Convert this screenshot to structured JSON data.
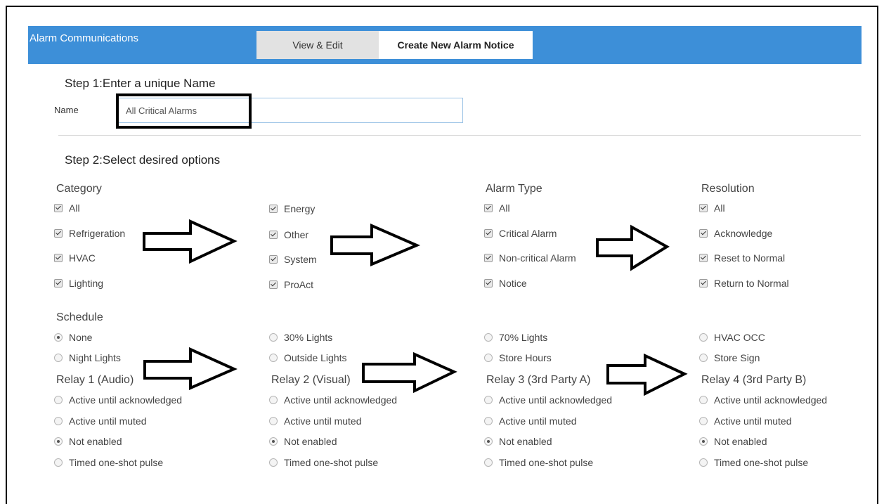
{
  "header": {
    "title": "Alarm Communications",
    "tabs": [
      {
        "label": "View & Edit"
      },
      {
        "label": "Create New Alarm Notice"
      }
    ]
  },
  "step1": {
    "heading": "Step 1:Enter a unique Name",
    "name_label": "Name",
    "name_value": "All Critical Alarms"
  },
  "step2": {
    "heading": "Step 2:Select desired options"
  },
  "category": {
    "title": "Category",
    "col1": [
      "All",
      "Refrigeration",
      "HVAC",
      "Lighting"
    ],
    "col2": [
      "Energy",
      "Other",
      "System",
      "ProAct"
    ]
  },
  "alarm_type": {
    "title": "Alarm Type",
    "items": [
      "All",
      "Critical Alarm",
      "Non-critical Alarm",
      "Notice"
    ]
  },
  "resolution": {
    "title": "Resolution",
    "items": [
      "All",
      "Acknowledge",
      "Reset to Normal",
      "Return to Normal"
    ]
  },
  "schedule": {
    "title": "Schedule",
    "items": [
      "None",
      "30% Lights",
      "70% Lights",
      "HVAC OCC",
      "Night Lights",
      "Outside Lights",
      "Store Hours",
      "Store Sign"
    ],
    "selected": "None"
  },
  "relays": [
    {
      "title": "Relay 1 (Audio)",
      "options": [
        "Active until acknowledged",
        "Active until muted",
        "Not enabled",
        "Timed one-shot pulse"
      ],
      "selected": "Not enabled"
    },
    {
      "title": "Relay 2 (Visual)",
      "options": [
        "Active until acknowledged",
        "Active until muted",
        "Not enabled",
        "Timed one-shot pulse"
      ],
      "selected": "Not enabled"
    },
    {
      "title": "Relay 3 (3rd Party A)",
      "options": [
        "Active until acknowledged",
        "Active until muted",
        "Not enabled",
        "Timed one-shot pulse"
      ],
      "selected": "Not enabled"
    },
    {
      "title": "Relay 4 (3rd Party B)",
      "options": [
        "Active until acknowledged",
        "Active until muted",
        "Not enabled",
        "Timed one-shot pulse"
      ],
      "selected": "Not enabled"
    }
  ],
  "colors": {
    "header_bg": "#3d8fd8",
    "tab_inactive_bg": "#e2e2e2",
    "input_border": "#9cc3e6",
    "annotation": "#000000"
  },
  "annotations": {
    "arrow_icon": "right-arrow-icon",
    "highlight": "black-rectangle"
  }
}
